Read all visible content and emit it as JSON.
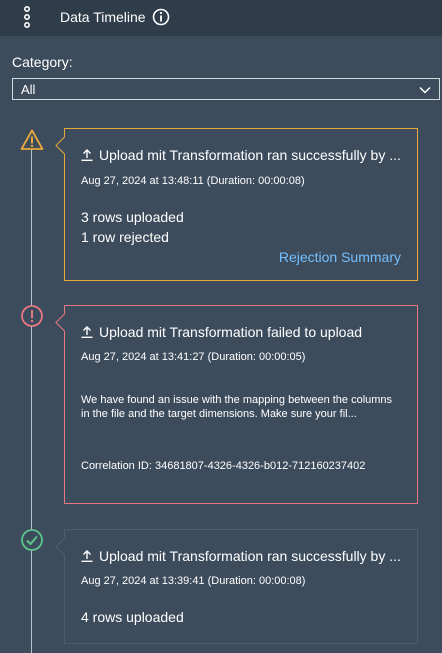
{
  "header": {
    "title": "Data Timeline"
  },
  "filter": {
    "label": "Category:",
    "selected": "All"
  },
  "entries": [
    {
      "status": "warning",
      "title": "Upload mit Transformation ran successfully by ...",
      "timestamp": "Aug 27, 2024 at 13:48:11 (Duration: 00:00:08)",
      "line1": "3 rows uploaded",
      "line2": "1 row rejected",
      "link": "Rejection Summary"
    },
    {
      "status": "error",
      "title": "Upload mit Transformation failed to upload",
      "timestamp": "Aug 27, 2024 at 13:41:27 (Duration: 00:00:05)",
      "message": "We have found an issue with the mapping between the columns in the file and the target dimensions. Make sure your fil...",
      "correlation": "Correlation ID: 34681807-4326-4326-b012-712160237402"
    },
    {
      "status": "success",
      "title": "Upload mit Transformation ran successfully by ...",
      "timestamp": "Aug 27, 2024 at 13:39:41 (Duration: 00:00:08)",
      "line1": "4 rows uploaded"
    }
  ],
  "colors": {
    "warning": "#e9a83a",
    "error": "#e87882",
    "success": "#5dc48a",
    "link": "#73c0ff"
  }
}
